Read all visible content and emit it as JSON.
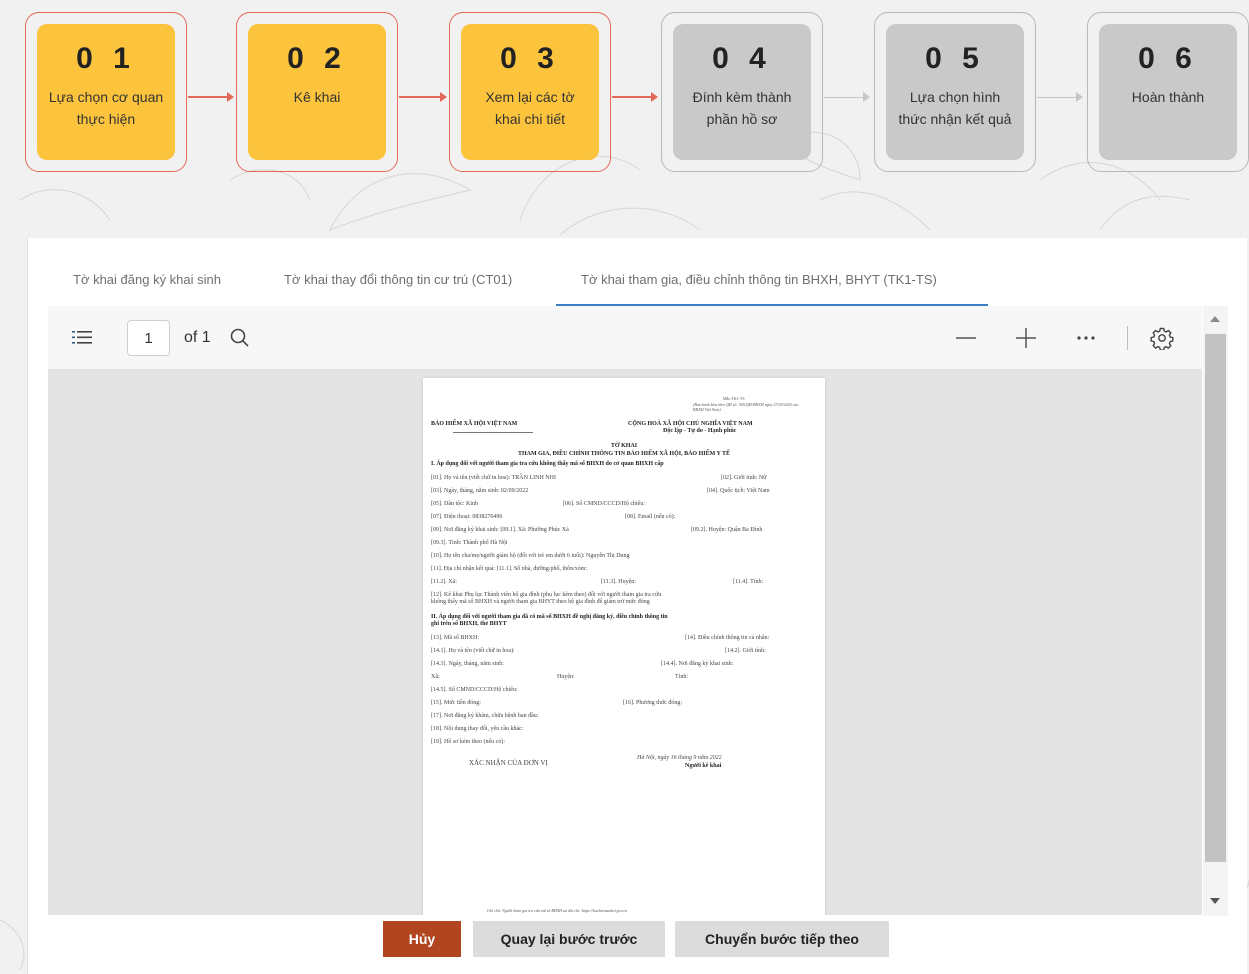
{
  "steps": [
    {
      "number": "0 1",
      "label": "Lựa chọn cơ quan thực hiện",
      "state": "done"
    },
    {
      "number": "0 2",
      "label": "Kê khai",
      "state": "done"
    },
    {
      "number": "0 3",
      "label": "Xem lại các tờ khai chi tiết",
      "state": "current"
    },
    {
      "number": "0 4",
      "label": "Đính kèm thành phần hồ sơ",
      "state": "pending"
    },
    {
      "number": "0 5",
      "label": "Lựa chọn hình thức nhận kết quả",
      "state": "pending"
    },
    {
      "number": "0 6",
      "label": "Hoàn thành",
      "state": "pending"
    }
  ],
  "tabs": [
    {
      "label": "Tờ khai đăng ký khai sinh"
    },
    {
      "label": "Tờ khai thay đổi thông tin cư trú (CT01)"
    },
    {
      "label": "Tờ khai tham gia, điều chỉnh thông tin BHXH, BHYT (TK1-TS)",
      "active": true
    }
  ],
  "viewer": {
    "page_current": "1",
    "page_total_label": "of 1",
    "icons": [
      "list-icon",
      "search-icon",
      "zoom-out-icon",
      "zoom-in-icon",
      "more-icon",
      "settings-icon"
    ]
  },
  "document": {
    "form_code": "Mẫu TK1-TS",
    "form_ref": "(Ban hành kèm theo QĐ số: 505/QĐ-BHXH ngày 27/03/2020 của BHXH Việt Nam)",
    "org_left": "BẢO HIỂM XÃ HỘI VIỆT NAM",
    "country": "CỘNG HOÀ XÃ HỘI CHỦ NGHĨA VIỆT NAM",
    "motto": "Độc lập - Tự do - Hạnh phúc",
    "title": "TỜ KHAI",
    "subtitle": "THAM GIA, ĐIỀU CHỈNH THÔNG TIN BẢO HIỂM XÃ HỘI, BẢO HIỂM Y TẾ",
    "section1": "I. Áp dụng đối với người tham gia tra cứu không thấy mã số BHXH do cơ quan BHXH cấp",
    "lines1": [
      {
        "left": "[01]. Họ và tên (viết chữ in hoa): TRẦN LINH NHI",
        "right": "[02]. Giới tính: Nữ"
      },
      {
        "left": "[03]. Ngày, tháng, năm sinh: 02/09/2022",
        "right": "[04]. Quốc tịch: Việt Nam"
      },
      {
        "left": "[05]. Dân tộc: Kinh",
        "mid": "[06]. Số CMND/CCCD/Hộ chiếu:"
      },
      {
        "left": "[07]. Điện thoại: 0838276496",
        "mid": "[08]. Email (nếu có):"
      },
      {
        "left": "[09]. Nơi đăng ký khai sinh: [09.1]. Xã: Phường Phúc Xá",
        "right": "[09.2]. Huyện: Quận Ba Đình"
      },
      {
        "left": "[09.3]. Tỉnh: Thành phố Hà Nội"
      },
      {
        "left": "[10]. Họ tên cha/mẹ/người giám hộ (đối với trẻ em dưới 6 tuổi): Nguyễn Thị Dung"
      },
      {
        "left": "[11]. Địa chỉ nhận kết quả: [11.1]. Số nhà, đường/phố, thôn/xóm:"
      },
      {
        "left": "[11.2]. Xã:",
        "mid": "[11.3]. Huyện:",
        "right": "[11.4]. Tỉnh:"
      },
      {
        "left": "[12]. Kê khai Phụ lục Thành viên hộ gia đình (phụ lục kèm theo) đối với người tham gia tra cứu"
      },
      {
        "left": "không thấy mã số BHXH và người tham gia BHYT theo hộ gia đình để giảm trừ mức đóng"
      }
    ],
    "section2a": "II. Áp dụng đối với người tham gia đã có mã số BHXH đề nghị đăng ký, điều chỉnh thông tin",
    "section2b": "ghi trên sổ BHXH, thẻ BHYT",
    "lines2": [
      {
        "left": "[13]. Mã số BHXH:",
        "right": "[14]. Điều chỉnh thông tin cá nhân:"
      },
      {
        "left": "[14.1]. Họ và tên (viết chữ in hoa):",
        "right": "[14.2]. Giới tính:"
      },
      {
        "left": "[14.3]. Ngày, tháng, năm sinh:",
        "right": "[14.4]. Nơi đăng ký khai sinh:"
      },
      {
        "left": "Xã:",
        "mid": "Huyện:",
        "right": "Tỉnh:"
      },
      {
        "left": "[14.5]. Số CMND/CCCD/Hộ chiếu:"
      },
      {
        "left": "[15]. Mức tiền đóng:",
        "mid": "[16]. Phương thức đóng:"
      },
      {
        "left": "[17]. Nơi đăng ký khám, chữa bệnh ban đầu:"
      },
      {
        "left": "[18]. Nội dung thay đổi, yêu cầu khác:"
      },
      {
        "left": "[19]. Hồ sơ kèm theo (nếu có):"
      }
    ],
    "confirm": "XÁC NHẬN CỦA ĐƠN VỊ",
    "date_line": "Hà Nội, ngày 16 tháng 9 năm 2022",
    "signer": "Người kê khai",
    "footer_note": "Ghi chú: Người tham gia tra cứu mã số BHXH tại địa chỉ: https://baohiemxahoi.gov.vn"
  },
  "buttons": {
    "cancel": "Hủy",
    "back": "Quay lại bước trước",
    "next": "Chuyển bước tiếp theo"
  },
  "colors": {
    "step_active": "#fcc33d",
    "step_inactive": "#c9c9c9",
    "outline_active": "#e36a5a",
    "tab_underline": "#3b82c4",
    "cancel_button": "#b0451f"
  }
}
